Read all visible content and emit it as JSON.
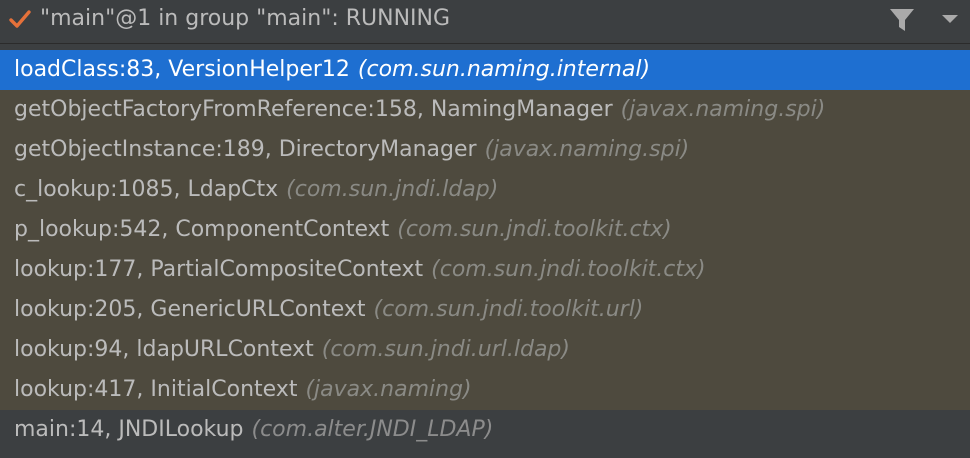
{
  "header": {
    "thread_title": "\"main\"@1 in group \"main\": RUNNING",
    "status_icon": "check-icon",
    "filter_icon": "filter-icon",
    "dropdown_icon": "chevron-down-icon",
    "status_color": "#e5713a"
  },
  "frames": [
    {
      "method": "loadClass:83, VersionHelper12",
      "package": "(com.sun.naming.internal)",
      "state": "selected"
    },
    {
      "method": "getObjectFactoryFromReference:158, NamingManager",
      "package": "(javax.naming.spi)",
      "state": "lib"
    },
    {
      "method": "getObjectInstance:189, DirectoryManager",
      "package": "(javax.naming.spi)",
      "state": "lib"
    },
    {
      "method": "c_lookup:1085, LdapCtx",
      "package": "(com.sun.jndi.ldap)",
      "state": "lib"
    },
    {
      "method": "p_lookup:542, ComponentContext",
      "package": "(com.sun.jndi.toolkit.ctx)",
      "state": "lib"
    },
    {
      "method": "lookup:177, PartialCompositeContext",
      "package": "(com.sun.jndi.toolkit.ctx)",
      "state": "lib"
    },
    {
      "method": "lookup:205, GenericURLContext",
      "package": "(com.sun.jndi.toolkit.url)",
      "state": "lib"
    },
    {
      "method": "lookup:94, ldapURLContext",
      "package": "(com.sun.jndi.url.ldap)",
      "state": "lib"
    },
    {
      "method": "lookup:417, InitialContext",
      "package": "(javax.naming)",
      "state": "lib"
    },
    {
      "method": "main:14, JNDILookup",
      "package": "(com.alter.JNDI_LDAP)",
      "state": "user"
    }
  ],
  "colors": {
    "selected_bg": "#1e6fd1",
    "library_bg": "#4e4a3e",
    "panel_bg": "#3c3f41"
  }
}
